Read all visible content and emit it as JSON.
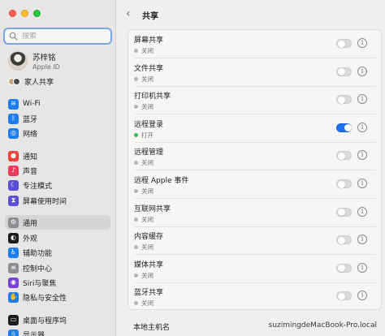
{
  "window": {
    "title": "共享"
  },
  "search": {
    "placeholder": "搜索"
  },
  "profile": {
    "name": "苏梓铭",
    "subtitle": "Apple ID"
  },
  "sidebar": {
    "items": [
      {
        "label": "家人共享",
        "icon": "family-icon"
      },
      {
        "label": "Wi-Fi",
        "icon": "wifi-icon",
        "color": "#1e7cf2"
      },
      {
        "label": "蓝牙",
        "icon": "bluetooth-icon",
        "color": "#1e7cf2"
      },
      {
        "label": "网络",
        "icon": "network-icon",
        "color": "#1e7cf2"
      },
      {
        "label": "通知",
        "icon": "notifications-icon",
        "color": "#f0443a"
      },
      {
        "label": "声音",
        "icon": "sound-icon",
        "color": "#ee3b5b"
      },
      {
        "label": "专注模式",
        "icon": "focus-icon",
        "color": "#5b4fd6"
      },
      {
        "label": "屏幕使用时间",
        "icon": "screen-time-icon",
        "color": "#5b4fd6"
      },
      {
        "label": "通用",
        "icon": "general-icon",
        "color": "#8e8e93",
        "selected": true
      },
      {
        "label": "外观",
        "icon": "appearance-icon",
        "color": "#1d1d1f"
      },
      {
        "label": "辅助功能",
        "icon": "accessibility-icon",
        "color": "#1e7cf2"
      },
      {
        "label": "控制中心",
        "icon": "control-center-icon",
        "color": "#8e8e93"
      },
      {
        "label": "Siri与聚焦",
        "icon": "siri-icon",
        "color": "#7a3fd6"
      },
      {
        "label": "隐私与安全性",
        "icon": "privacy-icon",
        "color": "#1e7cf2"
      },
      {
        "label": "桌面与程序坞",
        "icon": "desktop-dock-icon",
        "color": "#1d1d1f"
      },
      {
        "label": "显示器",
        "icon": "displays-icon",
        "color": "#1e7cf2"
      }
    ]
  },
  "services": [
    {
      "name": "屏幕共享",
      "status": "关闭",
      "on": false
    },
    {
      "name": "文件共享",
      "status": "关闭",
      "on": false
    },
    {
      "name": "打印机共享",
      "status": "关闭",
      "on": false
    },
    {
      "name": "远程登录",
      "status": "打开",
      "on": true
    },
    {
      "name": "远程管理",
      "status": "关闭",
      "on": false
    },
    {
      "name": "远程 Apple 事件",
      "status": "关闭",
      "on": false
    },
    {
      "name": "互联网共享",
      "status": "关闭",
      "on": false
    },
    {
      "name": "内容缓存",
      "status": "关闭",
      "on": false
    },
    {
      "name": "媒体共享",
      "status": "关闭",
      "on": false
    },
    {
      "name": "蓝牙共享",
      "status": "关闭",
      "on": false
    }
  ],
  "hostname": {
    "label": "本地主机名",
    "value": "suzimingdeMacBook-Pro.local"
  },
  "colors": {
    "accent": "#1e6ff0",
    "status_on": "#30c04f",
    "status_off": "#b8b6b4"
  }
}
